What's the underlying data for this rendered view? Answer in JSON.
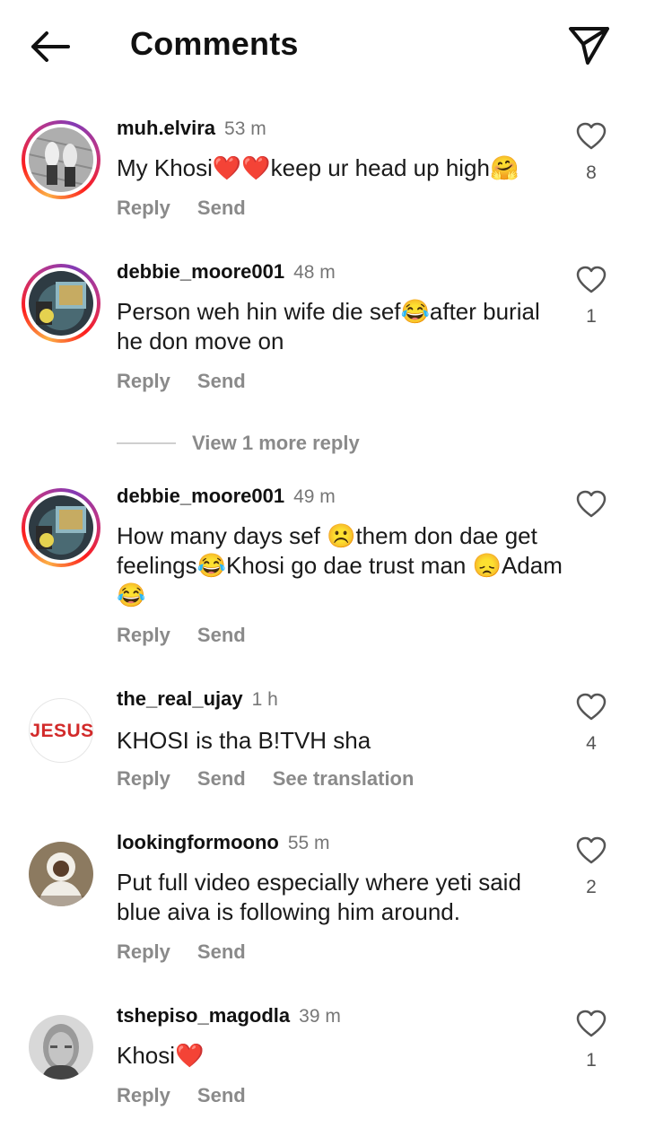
{
  "header": {
    "title": "Comments"
  },
  "comments": [
    {
      "username": "muh.elvira",
      "time": "53 m",
      "text": "My Khosi❤️❤️keep ur head up high🤗",
      "likes": "8",
      "reply": "Reply",
      "send": "Send"
    },
    {
      "username": "debbie_moore001",
      "time": "48 m",
      "text": "Person weh hin wife die sef😂after burial he don move on",
      "likes": "1",
      "reply": "Reply",
      "send": "Send",
      "view_more": "View 1 more reply"
    },
    {
      "username": "debbie_moore001",
      "time": "49 m",
      "text": "How many days sef ☹️them don dae get feelings😂Khosi go dae trust man 😞Adam😂",
      "likes": "",
      "reply": "Reply",
      "send": "Send"
    },
    {
      "username": "the_real_ujay",
      "time": "1 h",
      "text": "KHOSI is tha B!TVH sha",
      "likes": "4",
      "reply": "Reply",
      "send": "Send",
      "see_translation": "See translation",
      "avatar_text": "JESUS"
    },
    {
      "username": "lookingformoono",
      "time": "55 m",
      "text": "Put full video especially where yeti said blue aiva is following him around.",
      "likes": "2",
      "reply": "Reply",
      "send": "Send"
    },
    {
      "username": "tshepiso_magodla",
      "time": "39 m",
      "text": "Khosi❤️",
      "likes": "1",
      "reply": "Reply",
      "send": "Send"
    }
  ],
  "colors": {
    "text": "#111111",
    "secondary": "#8a8a8a",
    "heart_outline": "#555555",
    "ring_start": "#fcb045",
    "ring_mid": "#fd1d1d",
    "ring_end": "#833ab4"
  },
  "icons": {
    "back": "arrow-left-icon",
    "share": "paper-plane-icon",
    "like": "heart-outline-icon"
  }
}
